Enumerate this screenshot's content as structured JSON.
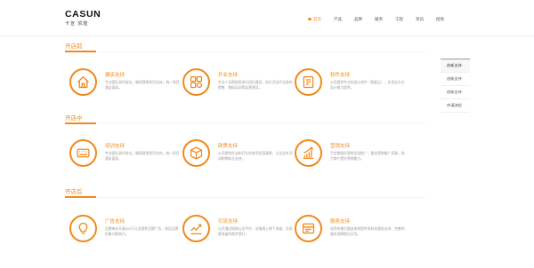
{
  "brand": {
    "name_en": "CASUN",
    "name_cn": "卡宣 凯隆"
  },
  "nav": {
    "items": [
      "首页",
      "产品",
      "品牌",
      "服务",
      "工程",
      "资讯",
      "招商"
    ],
    "active_index": 0
  },
  "sidebar": {
    "items": [
      "创新支持",
      "创新支持",
      "创新支持",
      "申请流程"
    ],
    "active_index": 0
  },
  "sections": [
    {
      "title": "开店前",
      "features": [
        {
          "title": "建店支持",
          "desc": "专业团队测评选址，确保营销系列支持，统一项目落店面局。",
          "icon": "house-icon"
        },
        {
          "title": "开业支持",
          "desc": "专业人员帮助您进行团队建设、执行活动开业前的销售、物料培训等运营督导。",
          "icon": "grid-icon"
        },
        {
          "title": "软件支持",
          "desc": "公司提供专业的设计软件（智能云），实现全方位设计能力提供。",
          "icon": "document-icon"
        }
      ]
    },
    {
      "title": "开店中",
      "features": [
        {
          "title": "培训支持",
          "desc": "专业团队测评选址，确保营销系列支持，统一项目落店面局。",
          "icon": "keyboard-icon"
        },
        {
          "title": "政策支持",
          "desc": "公司提供开店和开业的各项优惠政策，以及全年活动和物料全支持。",
          "icon": "box-icon"
        },
        {
          "title": "营销支持",
          "desc": "不定期组织营销活动推广，整合营销推广资源，助力商户提升营销能力。",
          "icon": "growth-chart-icon"
        }
      ]
    },
    {
      "title": "开店后",
      "features": [
        {
          "title": "广告支持",
          "desc": "品牌每年开展600万元全国性品牌广告，保证品牌形象与影响力。",
          "icon": "bulb-icon"
        },
        {
          "title": "引流支持",
          "desc": "公司通过网络以及平台，对接线上线下流量，实现客流量的稳步提升。",
          "icon": "line-chart-icon"
        },
        {
          "title": "服务支持",
          "desc": "成熟的售后服务体系提供多样化服务支持，完善的服务保障售后无忧。",
          "icon": "window-icon"
        }
      ]
    }
  ]
}
